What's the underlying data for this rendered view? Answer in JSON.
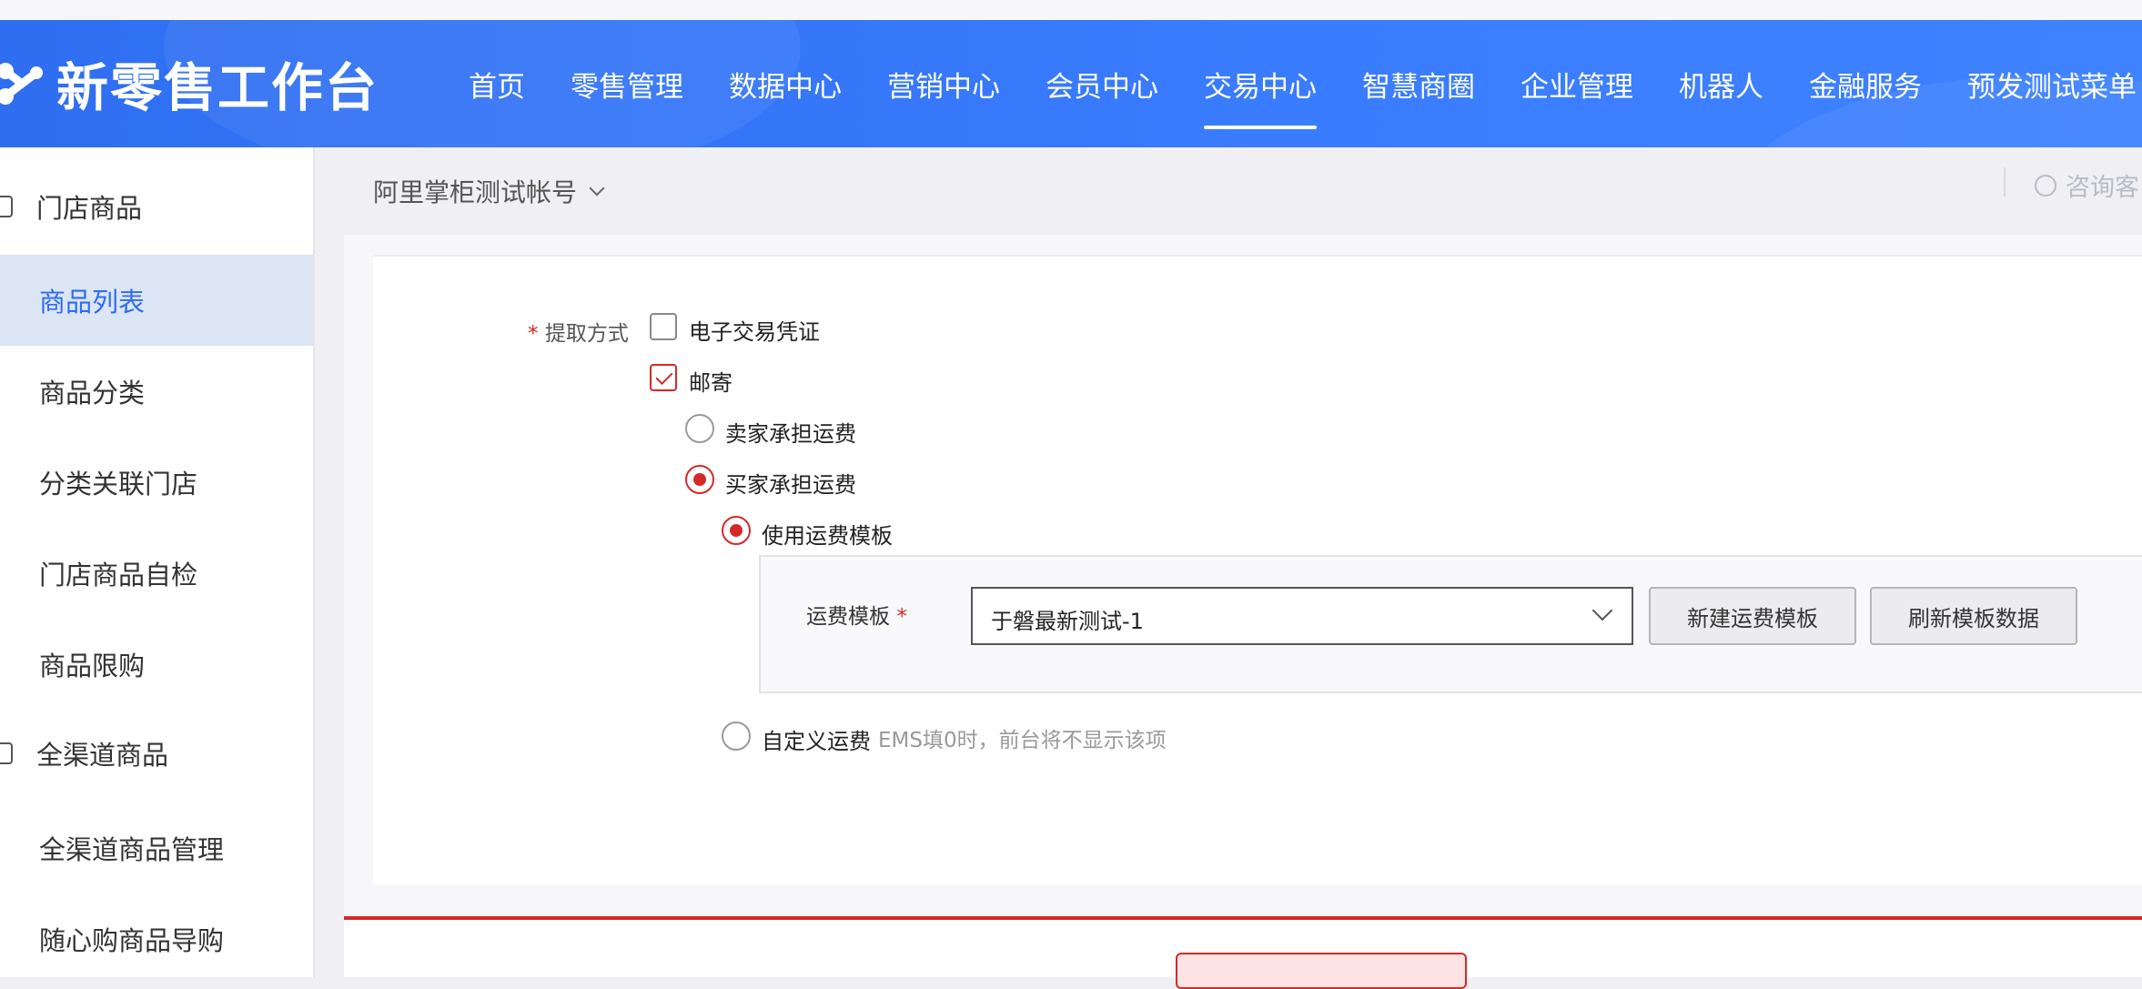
{
  "header": {
    "logo_text": "新零售工作台",
    "nav": [
      {
        "label": "首页"
      },
      {
        "label": "零售管理"
      },
      {
        "label": "数据中心"
      },
      {
        "label": "营销中心"
      },
      {
        "label": "会员中心"
      },
      {
        "label": "交易中心",
        "active": true
      },
      {
        "label": "智慧商圈"
      },
      {
        "label": "企业管理"
      },
      {
        "label": "机器人"
      },
      {
        "label": "金融服务"
      },
      {
        "label": "预发测试菜单"
      }
    ],
    "accent_color": "#3a7cff"
  },
  "sidebar": {
    "groups": [
      {
        "label": "门店商品",
        "icon": "store-goods-icon"
      },
      {
        "label": "全渠道商品",
        "icon": "omnichannel-goods-icon"
      }
    ],
    "items": [
      {
        "label": "商品列表",
        "active": true
      },
      {
        "label": "商品分类"
      },
      {
        "label": "分类关联门店"
      },
      {
        "label": "门店商品自检"
      },
      {
        "label": "商品限购"
      },
      {
        "label": "全渠道商品管理"
      },
      {
        "label": "随心购商品导购"
      }
    ]
  },
  "topbar": {
    "account": "阿里掌柜测试帐号",
    "consult": "咨询客"
  },
  "form": {
    "pickup_label": "提取方式",
    "required_mark": "*",
    "option_voucher": "电子交易凭证",
    "option_mail": "邮寄",
    "seller_pays": "卖家承担运费",
    "buyer_pays": "买家承担运费",
    "use_template": "使用运费模板",
    "template_label": "运费模板",
    "template_value": "于磐最新测试-1",
    "new_template_btn": "新建运费模板",
    "refresh_template_btn": "刷新模板数据",
    "custom_freight": "自定义运费",
    "custom_hint": "EMS填0时，前台将不显示该项"
  },
  "state": {
    "voucher_checked": false,
    "mail_checked": true,
    "freight_payer": "buyer",
    "buyer_mode": "template"
  },
  "colors": {
    "primary": "#2d6cf5",
    "danger": "#d62828"
  }
}
